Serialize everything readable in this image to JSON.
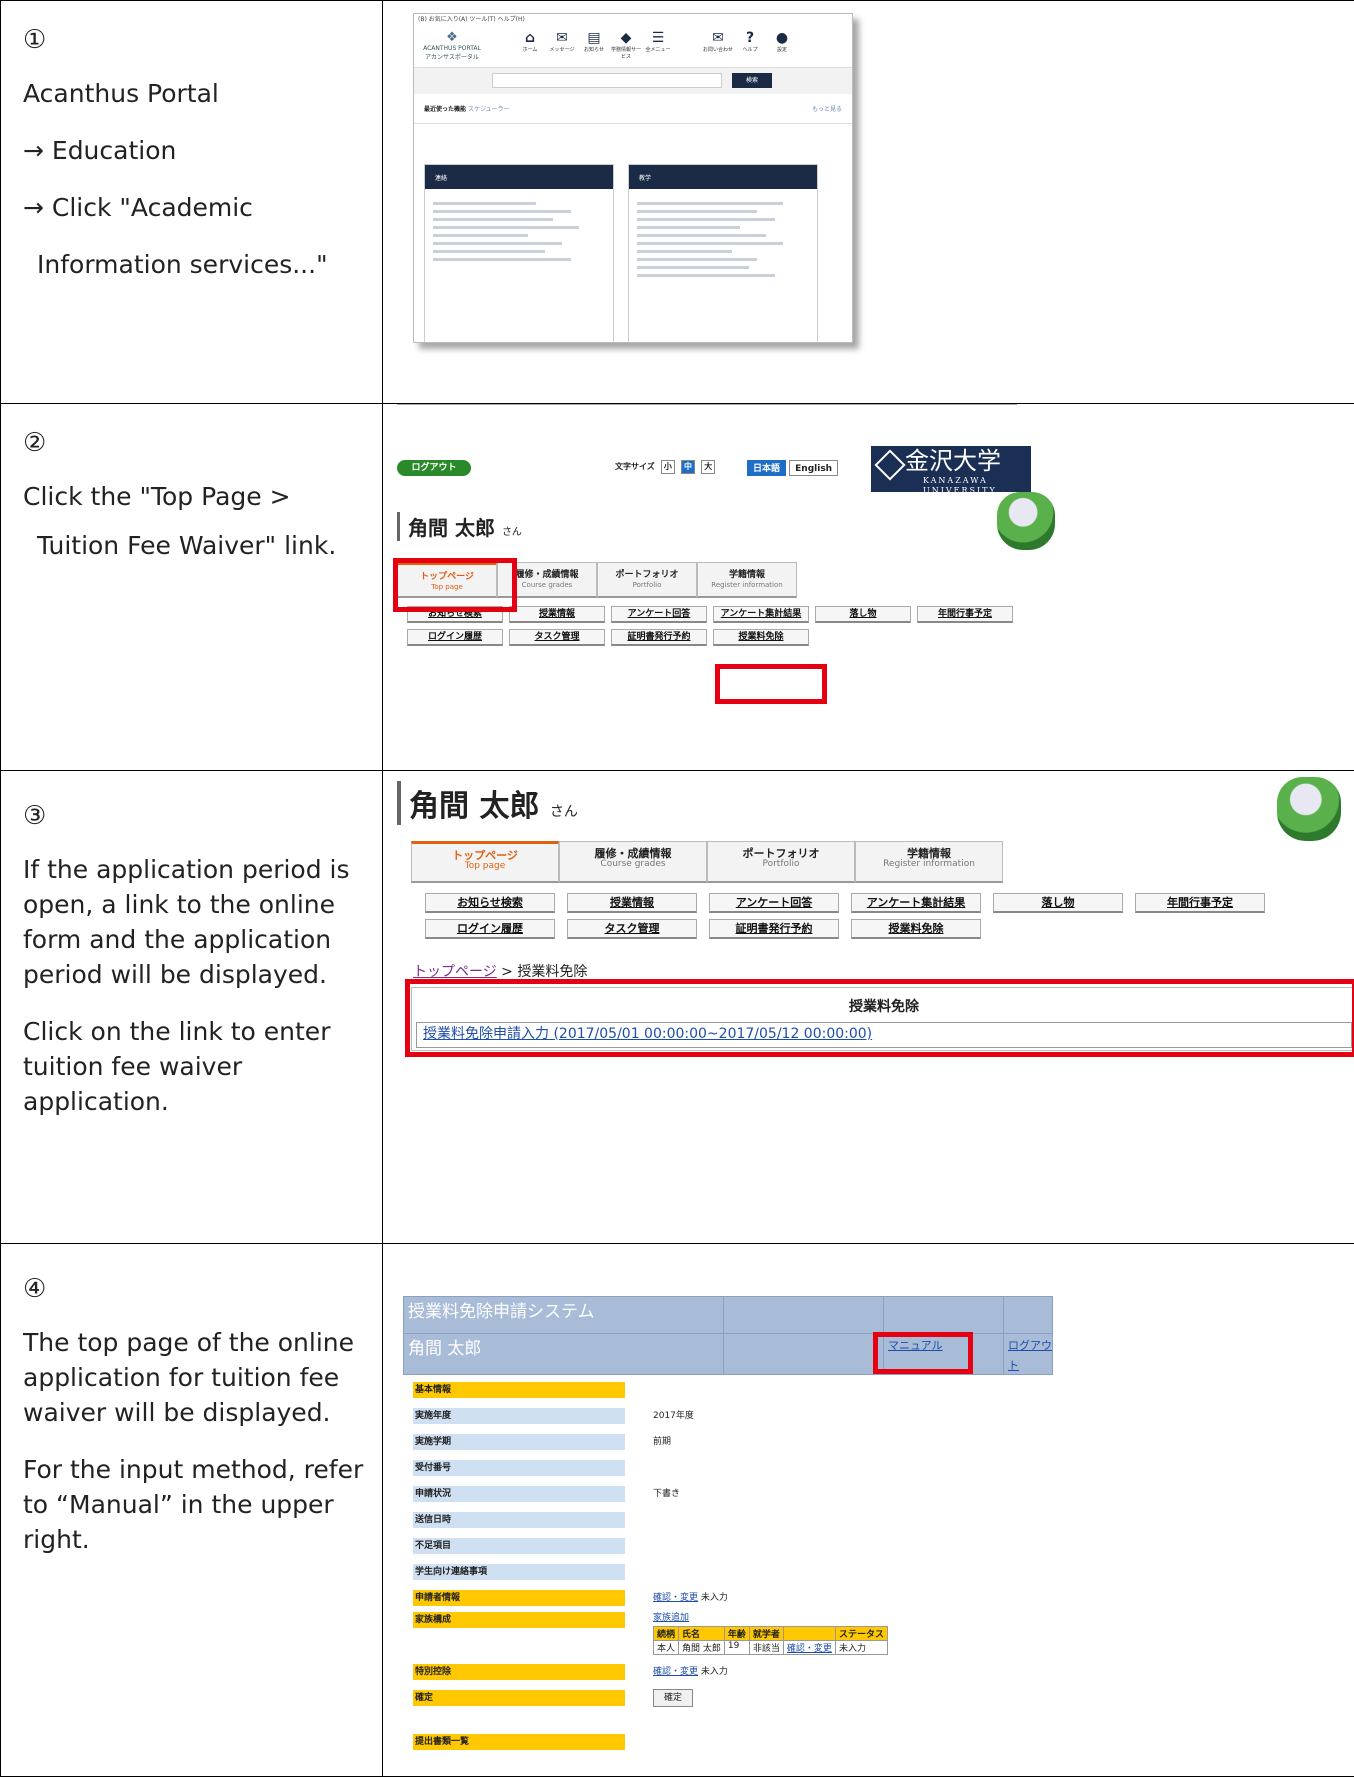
{
  "steps": [
    {
      "num": "①",
      "lines": [
        "Acanthus Portal",
        "→ Education",
        "→ Click \"Academic",
        "Information services...\""
      ]
    },
    {
      "num": "②",
      "lines": [
        "Click the \"Top Page >",
        "Tuition Fee Waiver\" link."
      ]
    },
    {
      "num": "③",
      "lines": [
        "If the application period is open, a link to the online form and the application period will be displayed.",
        "Click on the link to enter tuition fee waiver application."
      ]
    },
    {
      "num": "④",
      "lines": [
        "The top page of the online application for tuition fee waiver will be displayed.",
        "For the input method, refer to “Manual” in the upper right."
      ]
    }
  ],
  "portal": {
    "menubar": "(B) お気に入り(A) ツール(T) ヘルプ(H)",
    "logo": "ACANTHUS PORTAL",
    "logo_sub": "アカンサスポータル",
    "nav": [
      {
        "icon": "home-icon",
        "glyph": "⌂",
        "label": "ホーム"
      },
      {
        "icon": "mail-icon",
        "glyph": "✉",
        "label": "メッセージ"
      },
      {
        "icon": "news-icon",
        "glyph": "▤",
        "label": "お知らせ"
      },
      {
        "icon": "graduation-cap-icon",
        "glyph": "◆",
        "label": "学務情報サービス"
      },
      {
        "icon": "list-icon",
        "glyph": "☰",
        "label": "全メニュー"
      }
    ],
    "nav_right": [
      {
        "icon": "inquiry-icon",
        "glyph": "✉",
        "label": "お問い合わせ"
      },
      {
        "icon": "help-icon",
        "glyph": "?",
        "label": "ヘルプ"
      },
      {
        "icon": "settings-icon",
        "glyph": "●",
        "label": "設定"
      }
    ],
    "search_button": "検索",
    "recent_label": "最近使った機能",
    "recent_link": "スケジューラー",
    "recent_more": "もっと見る",
    "panel_left": "連絡",
    "panel_right": "教学"
  },
  "step2": {
    "logout": "ログアウト",
    "font_size_label": "文字サイズ",
    "font_sizes": [
      "小",
      "中",
      "大"
    ],
    "lang": [
      "日本語",
      "English"
    ],
    "university": "金沢大学",
    "university_en": "KANAZAWA UNIVERSITY",
    "user_name": "角間 太郎",
    "user_suffix": "さん",
    "tabs": [
      {
        "jp": "トップページ",
        "en": "Top page"
      },
      {
        "jp": "履修・成績情報",
        "en": "Course grades"
      },
      {
        "jp": "ポートフォリオ",
        "en": "Portfolio"
      },
      {
        "jp": "学籍情報",
        "en": "Register information"
      }
    ],
    "submenu_row1": [
      "お知らせ検索",
      "授業情報",
      "アンケート回答",
      "アンケート集計結果",
      "落し物",
      "年間行事予定"
    ],
    "submenu_row2": [
      "ログイン履歴",
      "タスク管理",
      "証明書発行予約",
      "授業料免除"
    ]
  },
  "step3": {
    "breadcrumb_link": "トップページ",
    "breadcrumb_rest": " > 授業料免除",
    "box_title": "授業料免除",
    "apply_link": "授業料免除申請入力 (2017/05/01 00:00:00~2017/05/12 00:00:00)"
  },
  "step4": {
    "system_title": "授業料免除申請システム",
    "user_name": "角間 太郎",
    "manual_link": "マニュアル",
    "logout_link": "ログアウト",
    "rows": [
      {
        "label": "基本情報",
        "style": "y",
        "value": ""
      },
      {
        "label": "実施年度",
        "style": "b",
        "value": "2017年度"
      },
      {
        "label": "実施学期",
        "style": "b",
        "value": "前期"
      },
      {
        "label": "受付番号",
        "style": "b",
        "value": ""
      },
      {
        "label": "申請状況",
        "style": "b",
        "value": "下書き"
      },
      {
        "label": "送信日時",
        "style": "b",
        "value": ""
      },
      {
        "label": "不足項目",
        "style": "b",
        "value": ""
      },
      {
        "label": "学生向け連絡事項",
        "style": "b",
        "value": ""
      },
      {
        "label": "申請者情報",
        "style": "y",
        "value": ""
      },
      {
        "label": "家族構成",
        "style": "y",
        "value": ""
      },
      {
        "label": "特別控除",
        "style": "y",
        "value": ""
      },
      {
        "label": "確定",
        "style": "y",
        "value": ""
      },
      {
        "label": "提出書類一覧",
        "style": "y",
        "value": ""
      }
    ],
    "applicant_link": "確認・変更",
    "applicant_status": "未入力",
    "family_add": "家族追加",
    "family_headers": [
      "続柄",
      "氏名",
      "年齢",
      "就学者",
      "",
      "ステータス"
    ],
    "family_row": [
      "本人",
      "角間 太郎",
      "19",
      "非該当",
      "確認・変更",
      "未入力"
    ],
    "special_link": "確認・変更",
    "special_status": "未入力",
    "confirm_button": "確定"
  }
}
